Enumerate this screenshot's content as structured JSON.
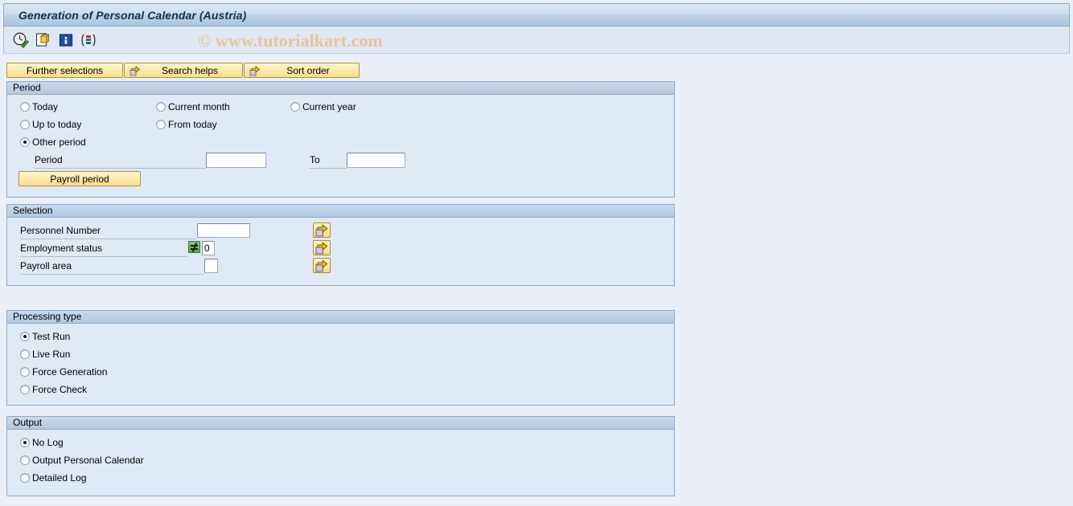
{
  "window": {
    "title": "Generation of Personal Calendar (Austria)"
  },
  "watermark": {
    "text": "© www.tutorialkart.com",
    "color": "#e7c49b"
  },
  "toolbar": {
    "icons": [
      {
        "name": "execute-clock-icon",
        "title": "Execute"
      },
      {
        "name": "save-variant-icon",
        "title": "Get Variant"
      },
      {
        "name": "information-icon",
        "title": "Information"
      },
      {
        "name": "multi-column-icon",
        "title": "Layout"
      }
    ]
  },
  "action_buttons": [
    {
      "label": "Further selections",
      "icon": null
    },
    {
      "label": "Search helps",
      "icon": "yellow-arrow-icon"
    },
    {
      "label": "Sort order",
      "icon": "yellow-arrow-icon"
    }
  ],
  "period": {
    "title": "Period",
    "options": [
      {
        "label": "Today",
        "selected": false
      },
      {
        "label": "Current month",
        "selected": false
      },
      {
        "label": "Current year",
        "selected": false
      },
      {
        "label": "Up to today",
        "selected": false
      },
      {
        "label": "From today",
        "selected": false
      },
      {
        "label": "Other period",
        "selected": true
      }
    ],
    "period_label": "Period",
    "period_value": "",
    "to_label": "To",
    "to_value": "",
    "payroll_button": "Payroll period"
  },
  "selection": {
    "title": "Selection",
    "rows": [
      {
        "label": "Personnel Number",
        "value": "",
        "operator": null,
        "multi_icon": "yellow-arrow-icon"
      },
      {
        "label": "Employment status",
        "value": "0",
        "operator": "not-equal",
        "multi_icon": "yellow-arrow-icon"
      },
      {
        "label": "Payroll area",
        "value": "",
        "operator": null,
        "multi_icon": "yellow-arrow-icon"
      }
    ]
  },
  "processing_type": {
    "title": "Processing type",
    "options": [
      {
        "label": "Test Run",
        "selected": true
      },
      {
        "label": "Live Run",
        "selected": false
      },
      {
        "label": "Force Generation",
        "selected": false
      },
      {
        "label": "Force Check",
        "selected": false
      }
    ]
  },
  "output": {
    "title": "Output",
    "options": [
      {
        "label": "No Log",
        "selected": true
      },
      {
        "label": "Output Personal Calendar",
        "selected": false
      },
      {
        "label": "Detailed Log",
        "selected": false
      }
    ]
  },
  "colors": {
    "page_background": "#eaeff7",
    "panel_background": "#dee9f5",
    "panel_header": "#bed1e6",
    "panel_border": "#8fa9c4",
    "button_yellow": "#fce9a8",
    "title_text": "#14314f",
    "operator_green": "#5da24b"
  }
}
